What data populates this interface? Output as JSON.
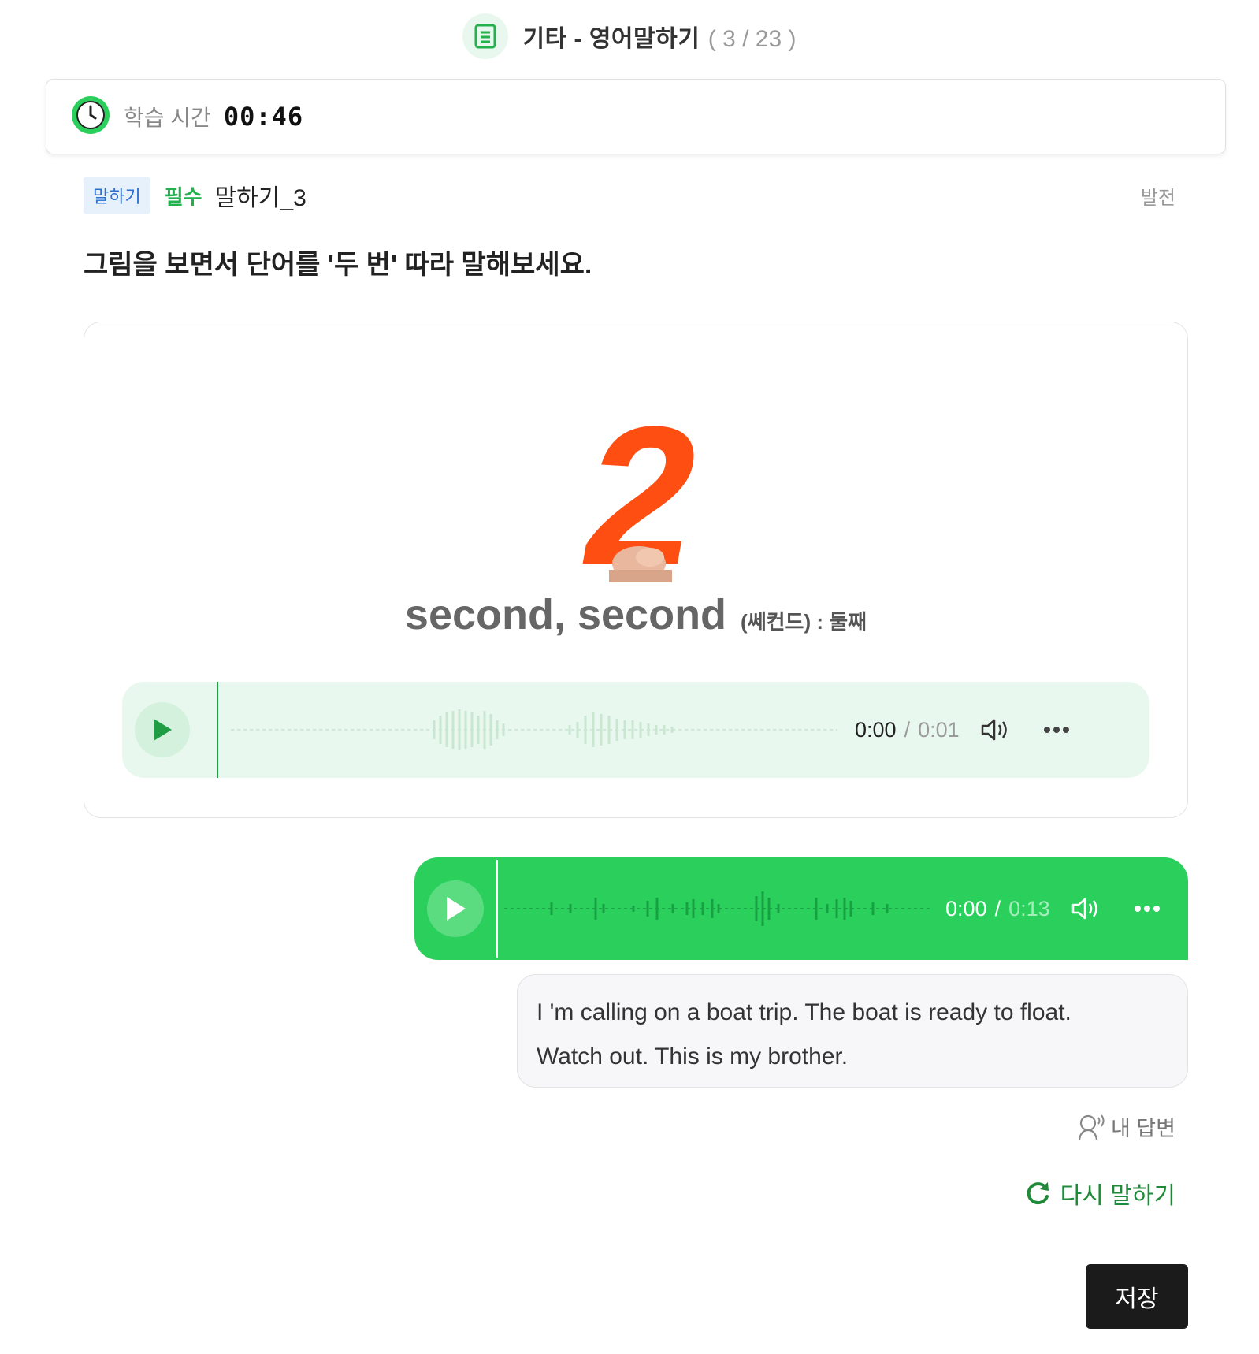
{
  "header": {
    "title": "기타 - 영어말하기",
    "progress": "( 3 / 23 )"
  },
  "timer": {
    "label": "학습 시간",
    "value": "00:46"
  },
  "question": {
    "type_badge": "말하기",
    "required_badge": "필수",
    "name": "말하기_3",
    "level": "발전",
    "instruction": "그림을 보면서 단어를 '두 번' 따라 말해보세요."
  },
  "card": {
    "image_number": "2",
    "word": "second, second",
    "meaning": "(쎄컨드) : 둘째"
  },
  "model_audio": {
    "current": "0:00",
    "separator": "/",
    "duration": "0:01"
  },
  "my_audio": {
    "current": "0:00",
    "separator": "/",
    "duration": "0:13"
  },
  "transcript": {
    "line1": "I 'm calling on a boat trip. The boat is ready to float.",
    "line2": "Watch out. This is my brother."
  },
  "labels": {
    "my_answer": "내 답변",
    "retry": "다시 말하기",
    "save": "저장"
  },
  "colors": {
    "accent_green": "#2bd05c",
    "dark_green": "#1f8a3a",
    "required_green": "#22b14c",
    "badge_blue": "#2b6fd1",
    "digit_orange": "#ff4e12"
  },
  "icons": {
    "header": "document-icon",
    "timer": "clock-icon",
    "play": "play-icon",
    "volume": "volume-icon",
    "more": "more-icon",
    "answer": "speaking-person-icon",
    "retry": "refresh-icon"
  }
}
